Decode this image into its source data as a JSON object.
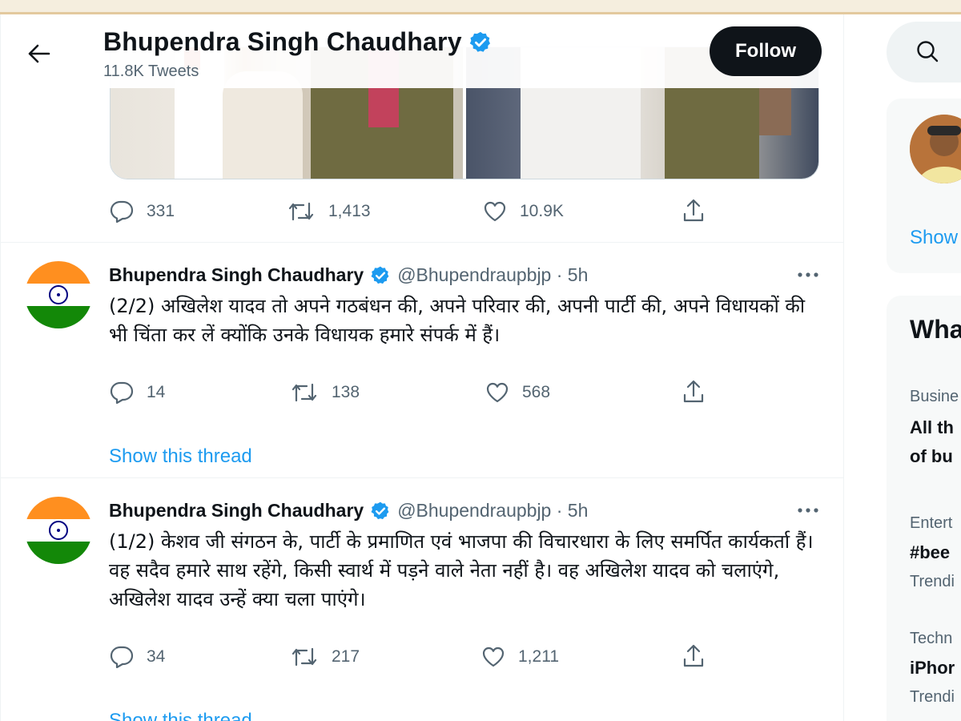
{
  "header": {
    "name": "Bhupendra Singh Chaudhary",
    "tweet_count": "11.8K Tweets",
    "follow_label": "Follow"
  },
  "media_tweet": {
    "reply_count": "331",
    "retweet_count": "1,413",
    "like_count": "10.9K"
  },
  "tweets": [
    {
      "name": "Bhupendra Singh Chaudhary",
      "handle": "@Bhupendraupbjp · 5h",
      "text": "(2/2) अखिलेश यादव तो अपने गठबंधन की, अपने परिवार की, अपनी पार्टी की, अपने विधायकों की भी चिंता कर लें क्योंकि उनके विधायक हमारे संपर्क में हैं।",
      "reply_count": "14",
      "retweet_count": "138",
      "like_count": "568",
      "thread_link": "Show this thread"
    },
    {
      "name": "Bhupendra Singh Chaudhary",
      "handle": "@Bhupendraupbjp · 5h",
      "text": "(1/2) केशव जी संगठन के, पार्टी के प्रमाणित एवं भाजपा की विचारधारा के लिए समर्पित कार्यकर्ता हैं। वह सदैव हमारे साथ रहेंगे, किसी स्वार्थ में पड़ने वाले नेता नहीं है। वह अखिलेश यादव को चलाएंगे, अखिलेश यादव उन्हें क्या चला पाएंगे।",
      "reply_count": "34",
      "retweet_count": "217",
      "like_count": "1,211",
      "thread_link": "Show this thread"
    }
  ],
  "sidebar": {
    "show_more": "Show",
    "whats_happening": "Wha",
    "trends": [
      {
        "category": "Busine",
        "title_lines": [
          "All th",
          "of bu"
        ],
        "sub": ""
      },
      {
        "category": "Entert",
        "title_lines": [
          "#bee"
        ],
        "sub": "Trendi"
      },
      {
        "category": "Techn",
        "title_lines": [
          "iPhor"
        ],
        "sub": "Trendi"
      }
    ]
  },
  "colors": {
    "accent": "#1d9bf0",
    "text": "#0f1419",
    "secondary": "#536471",
    "verified": "#1d9bf0",
    "follow_bg": "#0f1419"
  },
  "icons": [
    "back-arrow-icon",
    "verified-badge-icon",
    "reply-icon",
    "retweet-icon",
    "like-icon",
    "share-icon",
    "more-icon",
    "search-icon"
  ]
}
